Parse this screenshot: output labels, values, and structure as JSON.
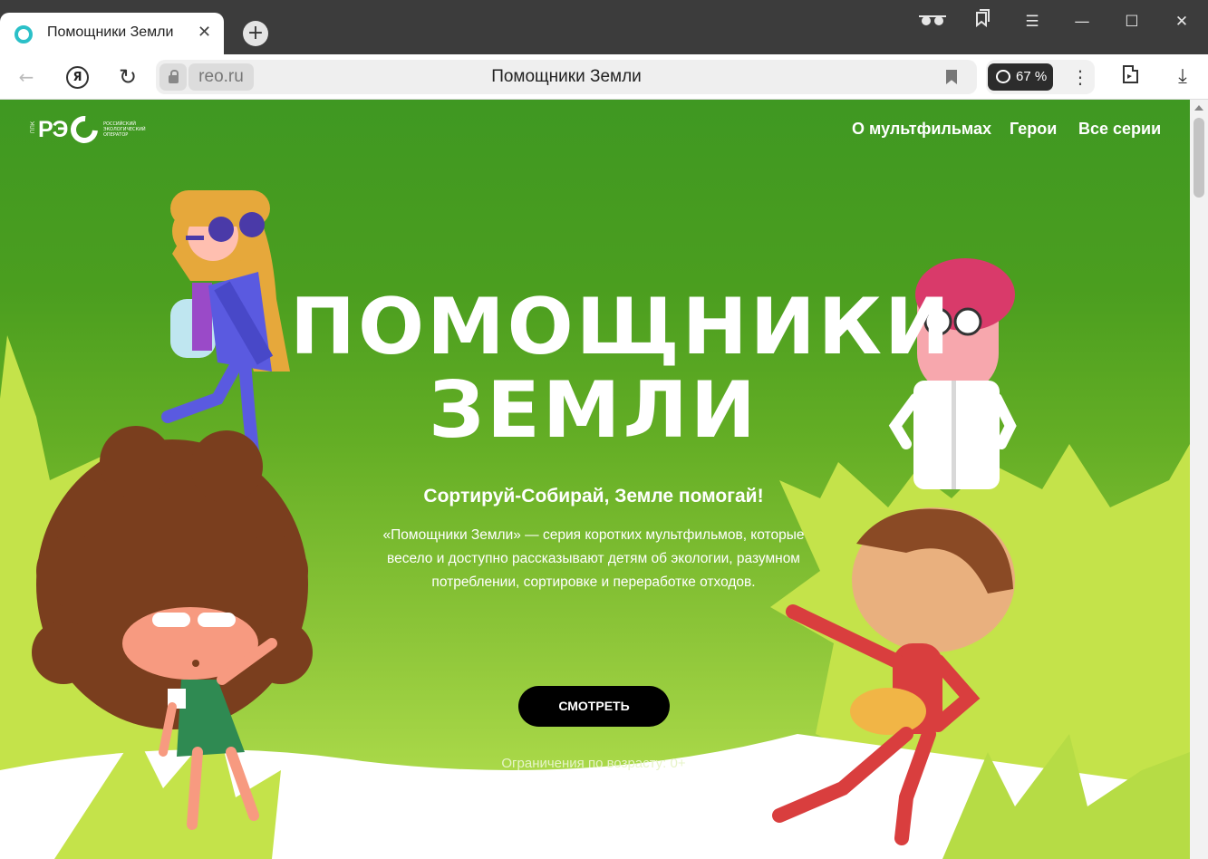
{
  "browser": {
    "tab_title": "Помощники Земли",
    "tab_close": "✕",
    "new_tab": "+",
    "address_domain": "reo.ru",
    "address_title": "Помощники Земли",
    "zoom": "67 %",
    "menu": "⋮",
    "window_buttons": [
      "⌐■■",
      "⧉",
      "☰",
      "—",
      "☐",
      "✕"
    ],
    "icons": {
      "back": "←",
      "yandex": "Я",
      "reload": "↻",
      "downloads": "⤓"
    }
  },
  "site": {
    "logo_text": "РЭ",
    "logo_ppk": "ППК",
    "logo_subtitle": "РОССИЙСКИЙ ЭКОЛОГИЧЕСКИЙ ОПЕРАТОР",
    "nav": [
      "О мультфильмах",
      "Герои",
      "Все серии"
    ]
  },
  "hero": {
    "title_line1": "ПОМОЩНИКИ",
    "title_line2": "ЗЕМЛИ",
    "tagline": "Сортируй-Собирай, Земле помогай!",
    "description": "«Помощники Земли» — серия коротких мультфильмов, которые весело и доступно рассказывают детям об экологии, разумном потреблении, сортировке и переработке отходов.",
    "watch_button": "СМОТРЕТЬ",
    "age_rating": "Ограничения по возрасту: 0+"
  },
  "colors": {
    "bg_top": "#3f9822",
    "bg_bottom": "#a9d848",
    "star": "#c4e34a",
    "button": "#000000"
  }
}
